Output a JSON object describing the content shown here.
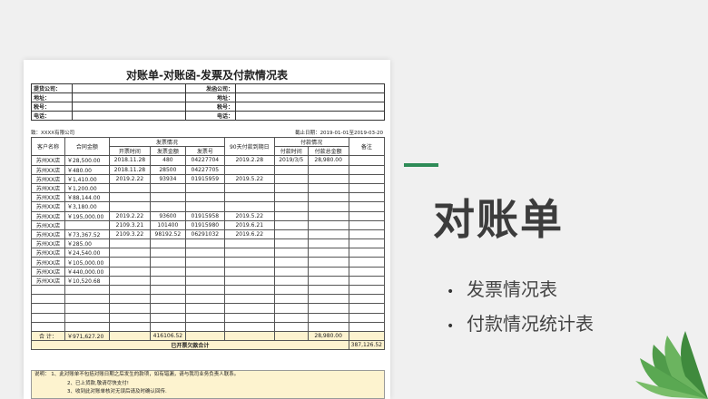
{
  "sheet": {
    "title": "对账单-对账函-发票及付款情况表",
    "header_labels": [
      "提货公司：",
      "发函公司：",
      "地址：",
      "地址：",
      "税号：",
      "税号：",
      "电话：",
      "电话："
    ],
    "to_label": "致：XXXX有限公司",
    "date_range": "截止日期：2019-01-01至2019-03-20",
    "columns": {
      "customer": "客户名称",
      "contract_amount": "合同金额",
      "invoice_group": "发票情况",
      "invoice_time": "开票时间",
      "invoice_amount": "发票金额",
      "invoice_no": "发票号",
      "due_date": "90天付款到期日",
      "payment_group": "付款情况",
      "pay_time": "付款时间",
      "pay_amount": "付款总金额",
      "remark": "备注"
    },
    "rows": [
      {
        "c": "苏州XX店",
        "amt": "￥28,500.00",
        "it": "2018.11.28",
        "ia": "480",
        "no": "04227704",
        "due": "2019.2.28",
        "pt": "2019/3/5",
        "pa": "28,980.00"
      },
      {
        "c": "苏州XX店",
        "amt": "￥480.00",
        "it": "2018.11.28",
        "ia": "28500",
        "no": "04227705",
        "due": "",
        "pt": "",
        "pa": ""
      },
      {
        "c": "苏州XX店",
        "amt": "￥1,410.00",
        "it": "2019.2.22",
        "ia": "93934",
        "no": "01915959",
        "due": "2019.5.22",
        "pt": "",
        "pa": ""
      },
      {
        "c": "苏州XX店",
        "amt": "￥1,200.00",
        "it": "",
        "ia": "",
        "no": "",
        "due": "",
        "pt": "",
        "pa": ""
      },
      {
        "c": "苏州XX店",
        "amt": "￥88,144.00",
        "it": "",
        "ia": "",
        "no": "",
        "due": "",
        "pt": "",
        "pa": ""
      },
      {
        "c": "苏州XX店",
        "amt": "￥3,180.00",
        "it": "",
        "ia": "",
        "no": "",
        "due": "",
        "pt": "",
        "pa": ""
      },
      {
        "c": "苏州XX店",
        "amt": "￥195,000.00",
        "it": "2019.2.22",
        "ia": "93600",
        "no": "01915958",
        "due": "2019.5.22",
        "pt": "",
        "pa": ""
      },
      {
        "c": "苏州XX店",
        "amt": "",
        "it": "2109.3.21",
        "ia": "101400",
        "no": "01915980",
        "due": "2019.6.21",
        "pt": "",
        "pa": ""
      },
      {
        "c": "苏州XX店",
        "amt": "￥73,367.52",
        "it": "2109.3.22",
        "ia": "98192.52",
        "no": "06291032",
        "due": "2019.6.22",
        "pt": "",
        "pa": ""
      },
      {
        "c": "苏州XX店",
        "amt": "￥285.00",
        "it": "",
        "ia": "",
        "no": "",
        "due": "",
        "pt": "",
        "pa": ""
      },
      {
        "c": "苏州XX店",
        "amt": "￥24,540.00",
        "it": "",
        "ia": "",
        "no": "",
        "due": "",
        "pt": "",
        "pa": ""
      },
      {
        "c": "苏州XX店",
        "amt": "￥105,000.00",
        "it": "",
        "ia": "",
        "no": "",
        "due": "",
        "pt": "",
        "pa": ""
      },
      {
        "c": "苏州XX店",
        "amt": "￥440,000.00",
        "it": "",
        "ia": "",
        "no": "",
        "due": "",
        "pt": "",
        "pa": ""
      },
      {
        "c": "苏州XX店",
        "amt": "￥10,520.68",
        "it": "",
        "ia": "",
        "no": "",
        "due": "",
        "pt": "",
        "pa": ""
      },
      {
        "c": "",
        "amt": "",
        "it": "",
        "ia": "",
        "no": "",
        "due": "",
        "pt": "",
        "pa": ""
      },
      {
        "c": "",
        "amt": "",
        "it": "",
        "ia": "",
        "no": "",
        "due": "",
        "pt": "",
        "pa": ""
      },
      {
        "c": "",
        "amt": "",
        "it": "",
        "ia": "",
        "no": "",
        "due": "",
        "pt": "",
        "pa": ""
      },
      {
        "c": "",
        "amt": "",
        "it": "",
        "ia": "",
        "no": "",
        "due": "",
        "pt": "",
        "pa": ""
      },
      {
        "c": "",
        "amt": "",
        "it": "",
        "ia": "",
        "no": "",
        "due": "",
        "pt": "",
        "pa": ""
      }
    ],
    "total": {
      "label": "合  计：",
      "amt": "￥971,627.20",
      "ia": "416106.52",
      "pa": "28,980.00"
    },
    "unpaid": {
      "label": "已开票欠款合计",
      "value": "387,126.52"
    },
    "notes": [
      "说明：  1、此对账单不包括对账日期之后发生的款项，如有错漏，请与我司业务负责人联系。",
      "2、已上货款,敬请尽快支付!",
      "3、收到此对账单核对无误后请及时确认回传."
    ]
  },
  "slide": {
    "title": "对账单",
    "bullets": [
      "发票情况表",
      "付款情况统计表"
    ],
    "accent_color": "#2e8b57"
  }
}
